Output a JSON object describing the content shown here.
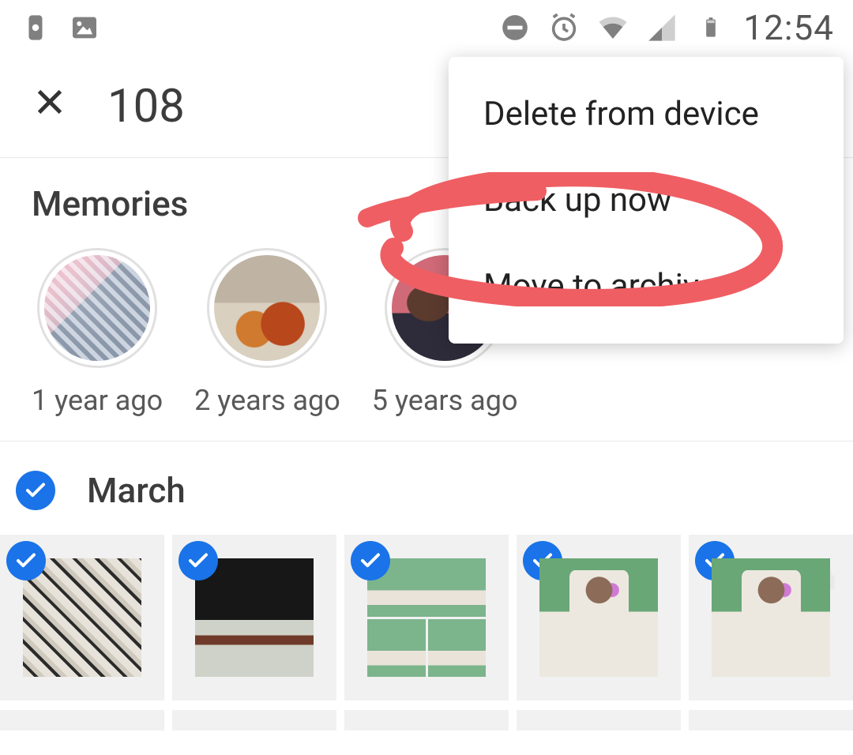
{
  "status_bar": {
    "time": "12:54"
  },
  "action_bar": {
    "selected_count": "108"
  },
  "memories": {
    "title": "Memories",
    "items": [
      {
        "label": "1 year ago"
      },
      {
        "label": "2 years ago"
      },
      {
        "label": "5 years ago"
      }
    ]
  },
  "month": {
    "title": "March"
  },
  "menu": {
    "items": [
      "Delete from device",
      "Back up now",
      "Move to archive"
    ]
  },
  "annotation": {
    "color": "#ef5e63",
    "target_menu_index": 1
  }
}
